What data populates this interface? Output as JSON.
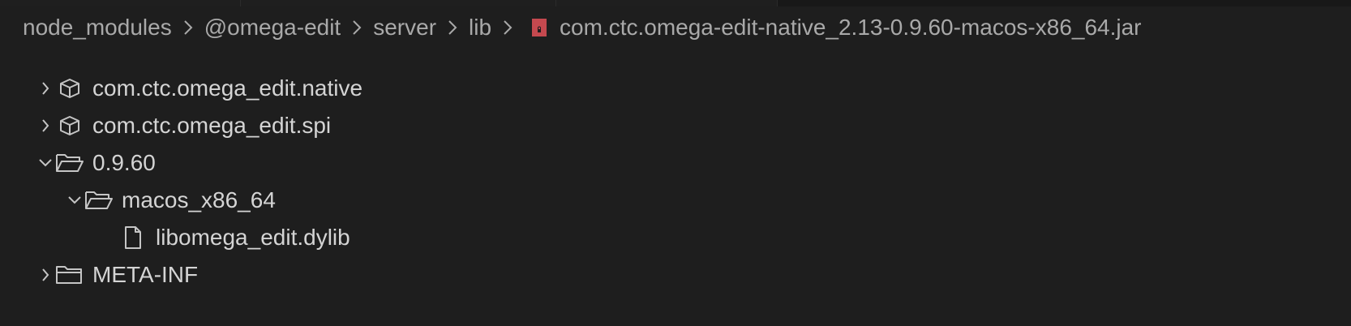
{
  "breadcrumb": {
    "items": [
      {
        "label": "node_modules"
      },
      {
        "label": "@omega-edit"
      },
      {
        "label": "server"
      },
      {
        "label": "lib"
      }
    ],
    "file": {
      "label": "com.ctc.omega-edit-native_2.13-0.9.60-macos-x86_64.jar",
      "icon": "jar-file-icon",
      "icon_color": "#c5494f"
    },
    "separator_icon": "chevron-right-icon"
  },
  "tree": {
    "items": [
      {
        "label": "com.ctc.omega_edit.native",
        "icon": "package-icon",
        "expanded": false
      },
      {
        "label": "com.ctc.omega_edit.spi",
        "icon": "package-icon",
        "expanded": false
      },
      {
        "label": "0.9.60",
        "icon": "folder-open-icon",
        "expanded": true
      },
      {
        "label": "macos_x86_64",
        "icon": "folder-open-icon",
        "expanded": true
      },
      {
        "label": "libomega_edit.dylib",
        "icon": "file-icon"
      },
      {
        "label": "META-INF",
        "icon": "folder-icon",
        "expanded": false
      }
    ]
  },
  "colors": {
    "background": "#1e1e1e",
    "text": "#d4d4d4",
    "breadcrumb_text": "#a9a9a9",
    "icon": "#c5c5c5"
  }
}
